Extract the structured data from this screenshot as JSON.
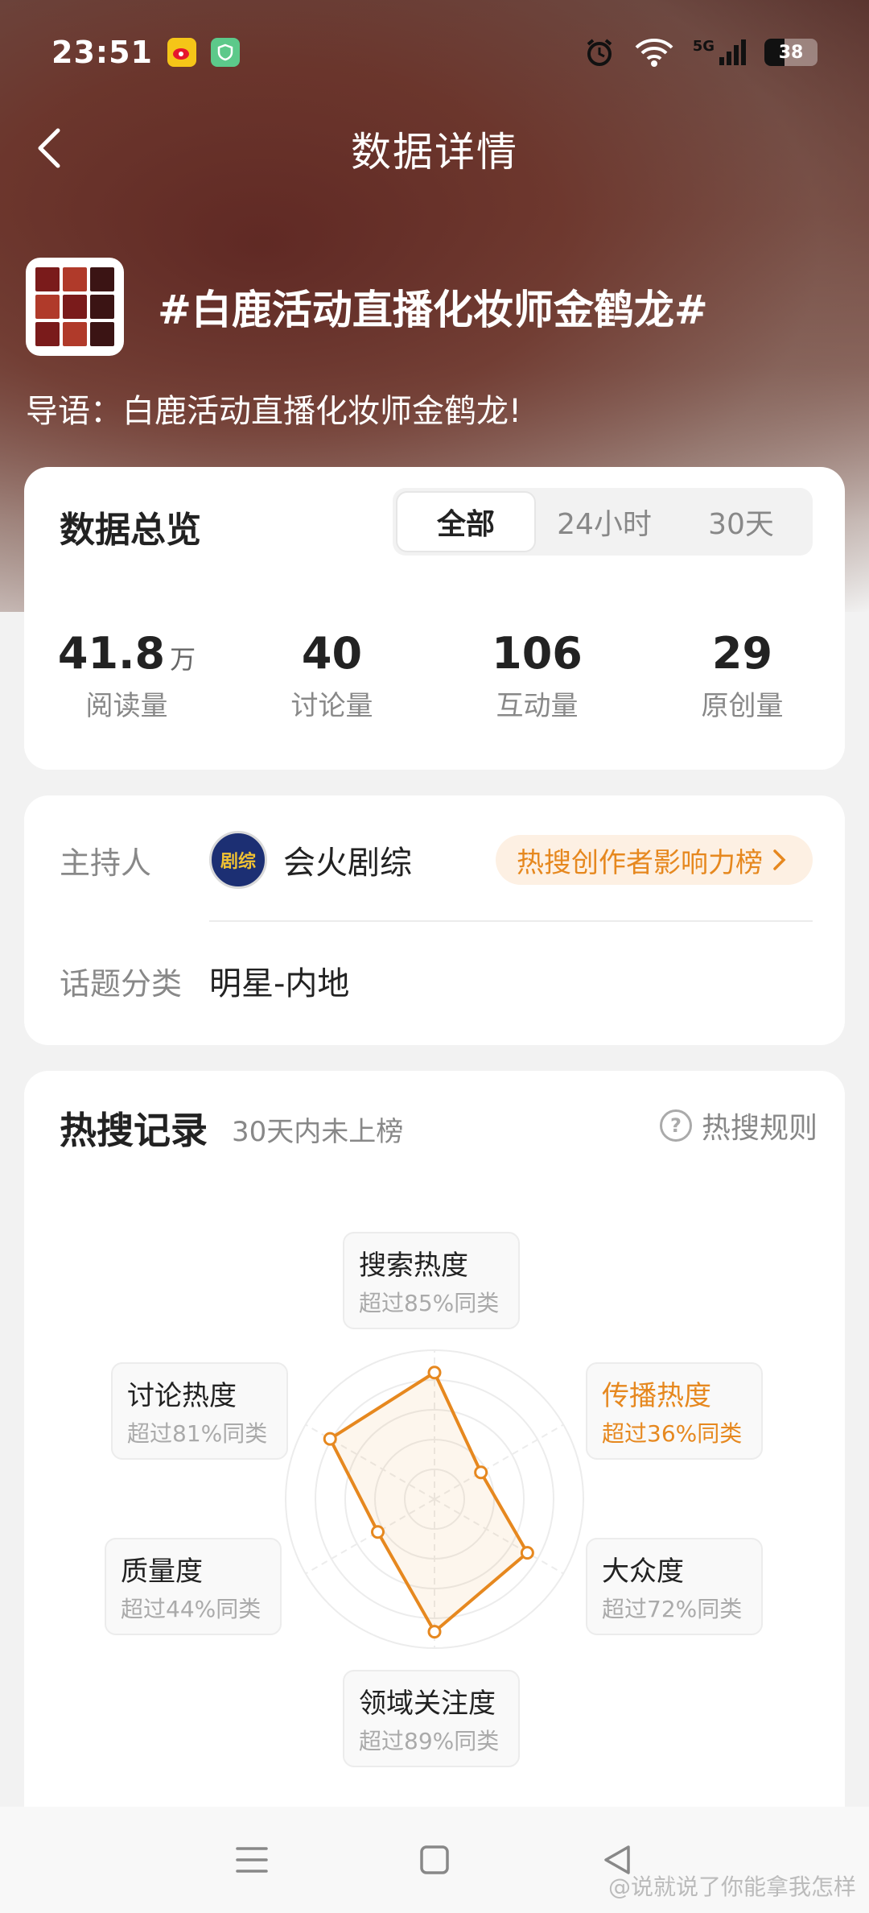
{
  "status_bar": {
    "time": "23:51",
    "network": "5G",
    "battery": "38",
    "app_icons": [
      "weibo-icon",
      "shield-app-icon"
    ]
  },
  "nav": {
    "title": "数据详情"
  },
  "topic": {
    "title": "#白鹿活动直播化妆师金鹤龙#",
    "lead": "导语：白鹿活动直播化妆师金鹤龙!"
  },
  "overview": {
    "title": "数据总览",
    "tabs": [
      "全部",
      "24小时",
      "30天"
    ],
    "active_tab": "全部",
    "stats": [
      {
        "value": "41.8",
        "unit": "万",
        "label": "阅读量"
      },
      {
        "value": "40",
        "unit": "",
        "label": "讨论量"
      },
      {
        "value": "106",
        "unit": "",
        "label": "互动量"
      },
      {
        "value": "29",
        "unit": "",
        "label": "原创量"
      }
    ]
  },
  "host": {
    "host_label": "主持人",
    "host_name": "会火剧综",
    "avatar_text": "剧综",
    "rank_badge": "热搜创作者影响力榜",
    "category_label": "话题分类",
    "category_value": "明星-内地"
  },
  "hot": {
    "title": "热搜记录",
    "subtitle": "30天内未上榜",
    "rules_label": "热搜规则",
    "metrics": [
      {
        "name": "搜索热度",
        "desc": "超过85%同类",
        "percent": 85
      },
      {
        "name": "传播热度",
        "desc": "超过36%同类",
        "percent": 36
      },
      {
        "name": "大众度",
        "desc": "超过72%同类",
        "percent": 72
      },
      {
        "name": "领域关注度",
        "desc": "超过89%同类",
        "percent": 89
      },
      {
        "name": "质量度",
        "desc": "超过44%同类",
        "percent": 44
      },
      {
        "name": "讨论热度",
        "desc": "超过81%同类",
        "percent": 81
      }
    ],
    "accent_color": "#e6881f"
  },
  "watermark": "@说就说了你能拿我怎样"
}
